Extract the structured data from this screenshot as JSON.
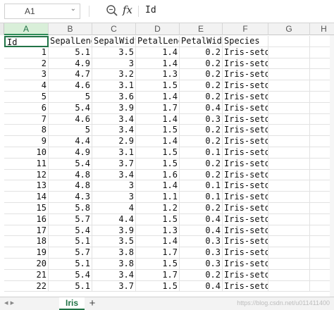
{
  "formula_bar": {
    "name_box": "A1",
    "formula_value": "Id",
    "fx_label": "fx"
  },
  "columns": [
    {
      "letter": "A",
      "header": "Id"
    },
    {
      "letter": "B",
      "header": "SepalLengthCm"
    },
    {
      "letter": "C",
      "header": "SepalWidthCm"
    },
    {
      "letter": "D",
      "header": "PetalLengthCm"
    },
    {
      "letter": "E",
      "header": "PetalWidthCm"
    },
    {
      "letter": "F",
      "header": "Species"
    },
    {
      "letter": "G",
      "header": ""
    },
    {
      "letter": "H",
      "header": ""
    }
  ],
  "header_row": [
    "Id",
    "SepalLengt",
    "SepalWidt",
    "PetalLengt",
    "PetalWidt",
    "Species"
  ],
  "rows": [
    [
      "1",
      "5.1",
      "3.5",
      "1.4",
      "0.2",
      "Iris-setosa"
    ],
    [
      "2",
      "4.9",
      "3",
      "1.4",
      "0.2",
      "Iris-setosa"
    ],
    [
      "3",
      "4.7",
      "3.2",
      "1.3",
      "0.2",
      "Iris-setosa"
    ],
    [
      "4",
      "4.6",
      "3.1",
      "1.5",
      "0.2",
      "Iris-setosa"
    ],
    [
      "5",
      "5",
      "3.6",
      "1.4",
      "0.2",
      "Iris-setosa"
    ],
    [
      "6",
      "5.4",
      "3.9",
      "1.7",
      "0.4",
      "Iris-setosa"
    ],
    [
      "7",
      "4.6",
      "3.4",
      "1.4",
      "0.3",
      "Iris-setosa"
    ],
    [
      "8",
      "5",
      "3.4",
      "1.5",
      "0.2",
      "Iris-setosa"
    ],
    [
      "9",
      "4.4",
      "2.9",
      "1.4",
      "0.2",
      "Iris-setosa"
    ],
    [
      "10",
      "4.9",
      "3.1",
      "1.5",
      "0.1",
      "Iris-setosa"
    ],
    [
      "11",
      "5.4",
      "3.7",
      "1.5",
      "0.2",
      "Iris-setosa"
    ],
    [
      "12",
      "4.8",
      "3.4",
      "1.6",
      "0.2",
      "Iris-setosa"
    ],
    [
      "13",
      "4.8",
      "3",
      "1.4",
      "0.1",
      "Iris-setosa"
    ],
    [
      "14",
      "4.3",
      "3",
      "1.1",
      "0.1",
      "Iris-setosa"
    ],
    [
      "15",
      "5.8",
      "4",
      "1.2",
      "0.2",
      "Iris-setosa"
    ],
    [
      "16",
      "5.7",
      "4.4",
      "1.5",
      "0.4",
      "Iris-setosa"
    ],
    [
      "17",
      "5.4",
      "3.9",
      "1.3",
      "0.4",
      "Iris-setosa"
    ],
    [
      "18",
      "5.1",
      "3.5",
      "1.4",
      "0.3",
      "Iris-setosa"
    ],
    [
      "19",
      "5.7",
      "3.8",
      "1.7",
      "0.3",
      "Iris-setosa"
    ],
    [
      "20",
      "5.1",
      "3.8",
      "1.5",
      "0.3",
      "Iris-setosa"
    ],
    [
      "21",
      "5.4",
      "3.4",
      "1.7",
      "0.2",
      "Iris-setosa"
    ],
    [
      "22",
      "5.1",
      "3.7",
      "1.5",
      "0.4",
      "Iris-setosa"
    ]
  ],
  "sheet_tabs": [
    {
      "label": "Iris",
      "active": true
    }
  ],
  "watermark": "https://blog.csdn.net/u011411400",
  "accent_color": "#217346"
}
